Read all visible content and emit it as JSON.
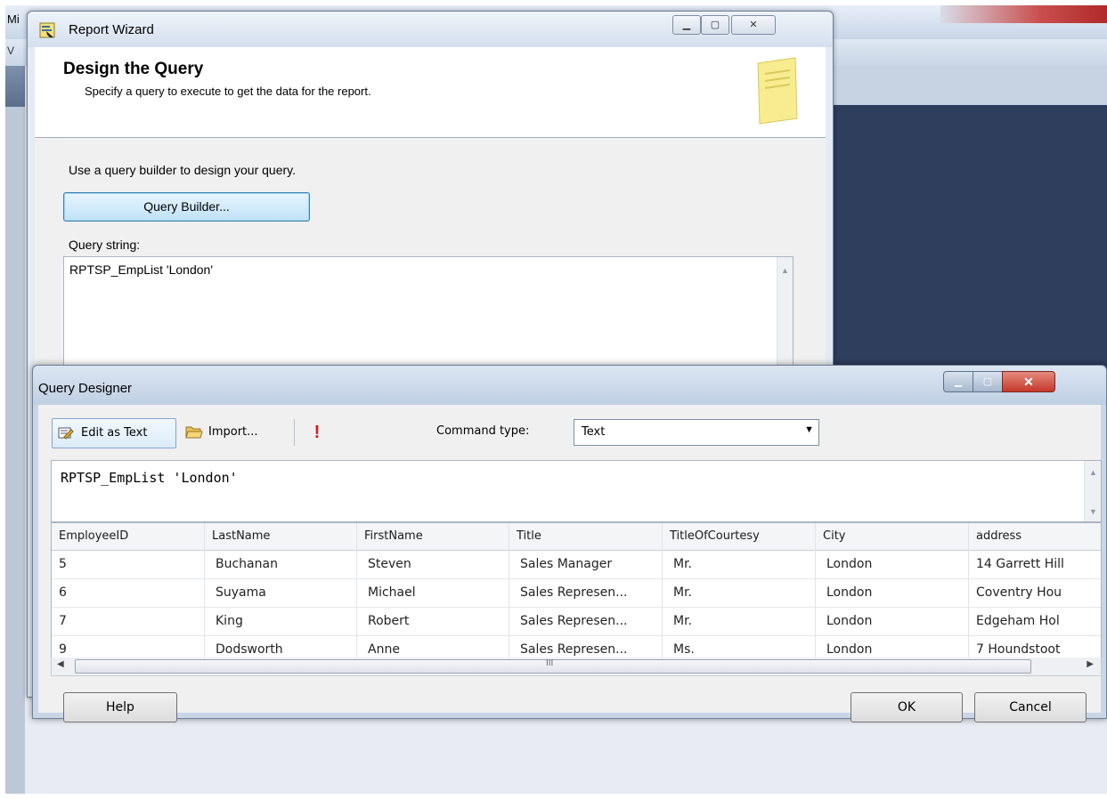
{
  "background": {
    "title_fragment": "Mi",
    "menu_fragment": "V"
  },
  "wizard": {
    "title": "Report Wizard",
    "heading": "Design the Query",
    "subheading": "Specify a query to execute to get the data for the report.",
    "hint": "Use a query builder to design your query.",
    "query_builder_label": "Query Builder...",
    "query_string_label": "Query string:",
    "query_string": "RPTSP_EmpList 'London'"
  },
  "query_designer": {
    "title": "Query Designer",
    "toolbar": {
      "edit_as_text": "Edit as Text",
      "import": "Import...",
      "run": "!",
      "command_type_label": "Command type:",
      "command_type_value": "Text"
    },
    "sql": "RPTSP_EmpList 'London'",
    "grid": {
      "columns": [
        "EmployeeID",
        "LastName",
        "FirstName",
        "Title",
        "TitleOfCourtesy",
        "City",
        "address"
      ],
      "rows": [
        [
          "5",
          "Buchanan",
          "Steven",
          "Sales Manager",
          "Mr.",
          "London",
          "14 Garrett Hill"
        ],
        [
          "6",
          "Suyama",
          "Michael",
          "Sales Represen...",
          "Mr.",
          "London",
          "Coventry Hou"
        ],
        [
          "7",
          "King",
          "Robert",
          "Sales Represen...",
          "Mr.",
          "London",
          "Edgeham Hol"
        ],
        [
          "9",
          "Dodsworth",
          "Anne",
          "Sales Represen...",
          "Ms.",
          "London",
          "7 Houndstoot"
        ]
      ]
    },
    "scroll_grip": "III",
    "buttons": {
      "help": "Help",
      "ok": "OK",
      "cancel": "Cancel"
    }
  }
}
